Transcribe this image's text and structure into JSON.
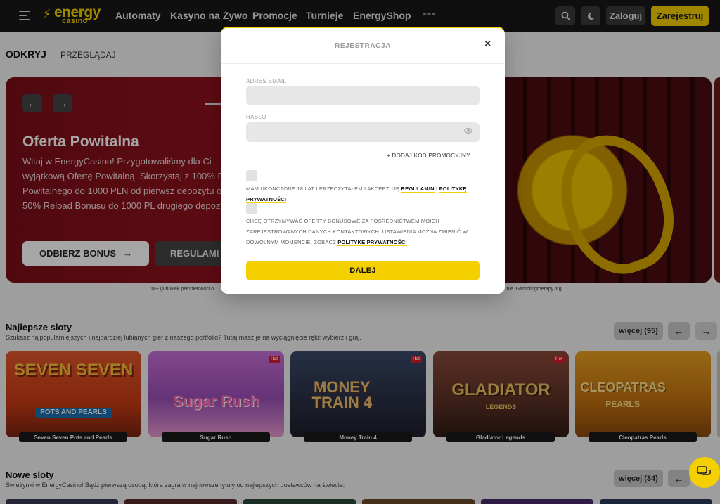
{
  "header": {
    "logo_energy": "energy",
    "logo_casino": "casino",
    "nav": [
      "Automaty",
      "Kasyno na Żywo",
      "Promocje",
      "Turnieje",
      "EnergyShop"
    ],
    "more": "•••",
    "login": "Zaloguj",
    "register": "Zarejestruj"
  },
  "subnav": {
    "active": "ODKRYJ",
    "link": "PRZEGLĄDAJ"
  },
  "hero": {
    "title": "Oferta Powitalna",
    "text": "Witaj w EnergyCasino! Przygotowaliśmy dla Ci wyjątkową Ofertę Powitalną. Skorzystaj z 100% Bonusu Powitalnego do 1000 PLN od pierwsz depozytu oraz 50% Reload Bonusu do 1000 PL drugiego depozytu.",
    "cta": "ODBIERZ BONUS",
    "terms": "REGULAMI",
    "disclaimer_left": "18+ (lub wiek pełnoletności o",
    "disclaimer_right": "lnie. Gamblingtherapy.org"
  },
  "best_slots": {
    "title": "Najlepsze sloty",
    "subtitle": "Szukasz najpopularniejszych i najbardziej lubianych gier z naszego portfolio? Tutaj masz je na wyciągnięcie ręki: wybierz i graj.",
    "more": "więcej (95)",
    "games": [
      {
        "label": "Seven Seven Pots and Pearls",
        "art": "SEVEN SEVEN",
        "sub": "POTS AND PEARLS",
        "hot": false
      },
      {
        "label": "Sugar Rush",
        "art": "Sugar Rush",
        "sub": "",
        "hot": true
      },
      {
        "label": "Money Train 4",
        "art": "MONEY TRAIN 4",
        "sub": "",
        "hot": true
      },
      {
        "label": "Gladiator Legends",
        "art": "GLADIATOR",
        "sub": "LEGENDS",
        "hot": true
      },
      {
        "label": "Cleopatras Pearls",
        "art": "CLEOPATRAS",
        "sub": "PEARLS",
        "hot": false
      }
    ],
    "hot_badge": "Hot"
  },
  "new_slots": {
    "title": "Nowe sloty",
    "subtitle": "Świeżynki w EnergyCasino! Bądź pierwszą osobą, która zagra w najnowsze tytuły od najlepszych dostawców na świecie.",
    "more": "więcej (34)"
  },
  "modal": {
    "title": "REJESTRACJA",
    "close": "×",
    "email_label": "ADRES EMAIL",
    "email_value": "",
    "password_label": "HASŁO",
    "password_value": "",
    "promo": "+  DODAJ KOD PROMOCYJNY",
    "consent1_prefix": "MAM UKOŃCZONE 18 LAT I PRZECZYTAŁEM I AKCEPTUJĘ",
    "consent1_link1": "REGULAMIN",
    "consent1_sep": "I",
    "consent1_link2": "POLITYKĘ PRYWATNOŚCI",
    "consent2_text": "CHCĘ OTRZYMYWAĆ OFERTY BONUSOWE ZA POŚREDNICTWEM MOICH ZAREJESTROWANYCH DANYCH KONTAKTOWYCH. USTAWIENIA MOŻNA ZMIENIĆ W DOWOLNYM MOMENCIE, ZOBACZ",
    "consent2_link": "POLITYKĘ PRYWATNOŚCI",
    "next": "DALEJ"
  },
  "icons": {
    "hamburger": "hamburger-icon",
    "search": "search-icon",
    "theme": "moon-icon",
    "close": "close-icon",
    "eye": "eye-icon",
    "chat": "chat-icon"
  },
  "colors": {
    "brand_yellow": "#f5d000",
    "header_bg": "#171717",
    "hot": "#d81c2a"
  }
}
